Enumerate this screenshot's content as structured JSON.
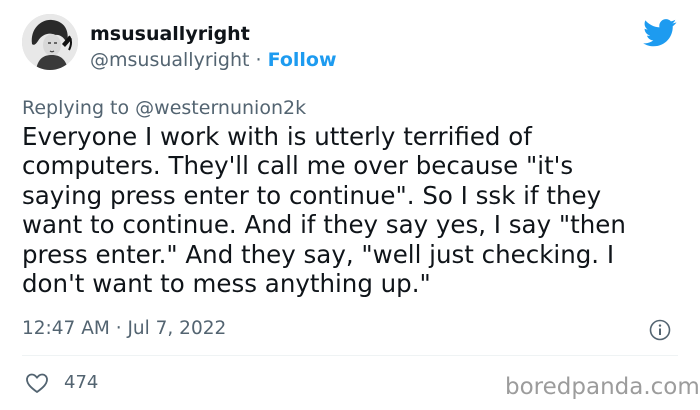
{
  "tweet": {
    "display_name": "msusuallyright",
    "handle": "@msusuallyright",
    "separator": "·",
    "follow_label": "Follow",
    "replying_prefix": "Replying to",
    "replying_to": "@westernunion2k",
    "text": "Everyone I work with is utterly terrified of\ncomputers. They'll call me over because \"it's\nsaying press enter to continue\". So I ssk if they\nwant to continue. And if they say yes, I say \"then\npress enter.\" And they say, \"well just checking. I\ndon't want to mess anything up.\"",
    "timestamp": "12:47 AM · Jul 7, 2022",
    "like_count": "474"
  },
  "icons": {
    "brand": "twitter-bird-icon",
    "info": "info-icon",
    "like": "heart-icon"
  },
  "colors": {
    "link": "#1d9bf0",
    "secondary_text": "#536471",
    "primary_text": "#0f1419"
  },
  "watermark": "boredpanda.com"
}
